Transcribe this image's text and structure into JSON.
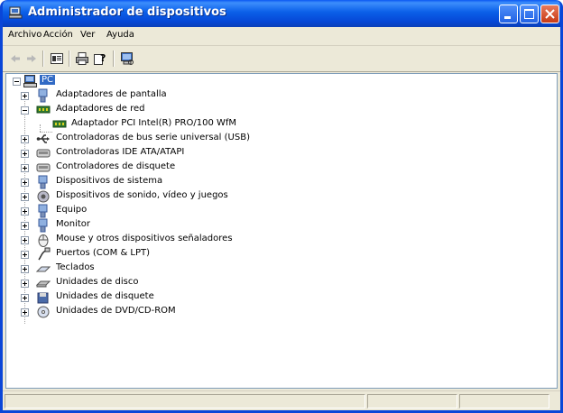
{
  "window": {
    "title": "Administrador de dispositivos",
    "title_bar_color": "#0a58f2",
    "close_color": "#c73a15"
  },
  "menubar": {
    "items": [
      "Archivo",
      "Acción",
      "Ver",
      "Ayuda"
    ]
  },
  "toolbar": {
    "icons": [
      "back-arrow-icon",
      "forward-arrow-icon",
      "properties-icon",
      "print-icon",
      "help-icon",
      "scan-hardware-icon"
    ]
  },
  "tree": {
    "root": "PC",
    "categories": [
      {
        "label": "Adaptadores de pantalla",
        "icon": "display-adapter-icon",
        "expanded": false
      },
      {
        "label": "Adaptadores de red",
        "icon": "network-adapter-icon",
        "expanded": true,
        "children": [
          {
            "label": "Adaptador PCI Intel(R) PRO/100 WfM",
            "icon": "network-card-icon"
          }
        ]
      },
      {
        "label": "Controladoras de bus serie universal (USB)",
        "icon": "usb-icon",
        "expanded": false
      },
      {
        "label": "Controladoras IDE ATA/ATAPI",
        "icon": "ide-controller-icon",
        "expanded": false
      },
      {
        "label": "Controladores de disquete",
        "icon": "floppy-controller-icon",
        "expanded": false
      },
      {
        "label": "Dispositivos de sistema",
        "icon": "system-device-icon",
        "expanded": false
      },
      {
        "label": "Dispositivos de sonido, vídeo y juegos",
        "icon": "sound-icon",
        "expanded": false
      },
      {
        "label": "Equipo",
        "icon": "computer-icon",
        "expanded": false
      },
      {
        "label": "Monitor",
        "icon": "monitor-icon",
        "expanded": false
      },
      {
        "label": "Mouse y otros dispositivos señaladores",
        "icon": "mouse-icon",
        "expanded": false
      },
      {
        "label": "Puertos (COM & LPT)",
        "icon": "port-icon",
        "expanded": false
      },
      {
        "label": "Teclados",
        "icon": "keyboard-icon",
        "expanded": false
      },
      {
        "label": "Unidades de disco",
        "icon": "disk-drive-icon",
        "expanded": false
      },
      {
        "label": "Unidades de disquete",
        "icon": "floppy-drive-icon",
        "expanded": false
      },
      {
        "label": "Unidades de DVD/CD-ROM",
        "icon": "dvd-drive-icon",
        "expanded": false
      }
    ]
  }
}
